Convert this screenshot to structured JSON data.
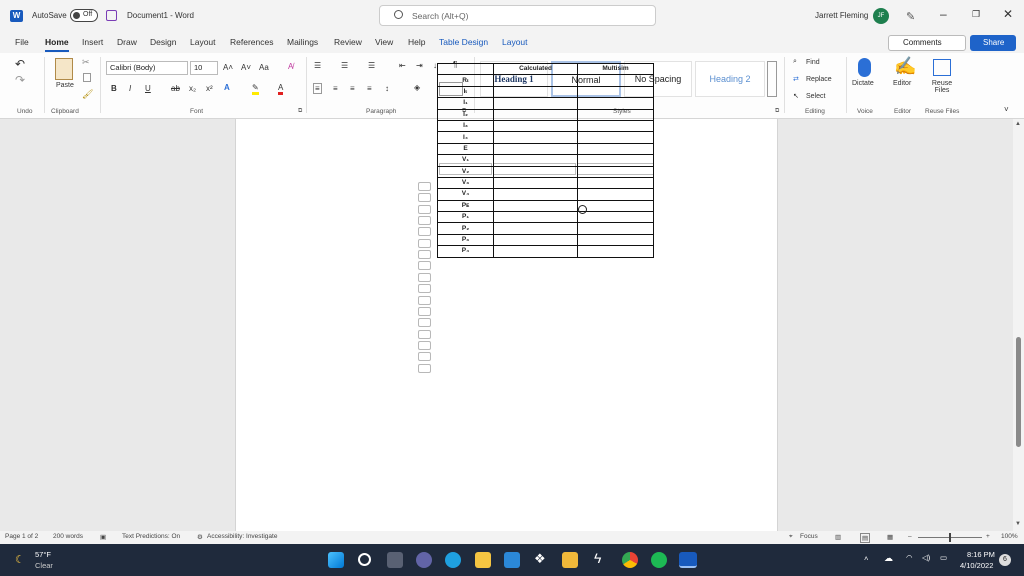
{
  "titlebar": {
    "app_logo": "W",
    "autosave_label": "AutoSave",
    "autosave_state": "Off",
    "doc_title": "Document1  -  Word",
    "search_placeholder": "Search (Alt+Q)",
    "user_name": "Jarrett Fleming",
    "user_initials": "JF"
  },
  "tabs": [
    "File",
    "Home",
    "Insert",
    "Draw",
    "Design",
    "Layout",
    "References",
    "Mailings",
    "Review",
    "View",
    "Help",
    "Table Design",
    "Layout"
  ],
  "active_tab": "Home",
  "comments_label": "Comments",
  "share_label": "Share",
  "ribbon": {
    "undo_label": "Undo",
    "paste_label": "Paste",
    "clipboard_label": "Clipboard",
    "font_name": "Calibri (Body)",
    "font_size": "10",
    "font_label": "Font",
    "paragraph_label": "Paragraph",
    "styles_label": "Styles",
    "styles": [
      "Heading 1",
      "Normal",
      "No Spacing",
      "Heading 2"
    ],
    "selected_style": "Normal",
    "find_label": "Find",
    "replace_label": "Replace",
    "select_label": "Select",
    "editing_label": "Editing",
    "dictate_label": "Dictate",
    "voice_label": "Voice",
    "editor_label": "Editor",
    "editor_group_label": "Editor",
    "reuse_label": "Reuse Files",
    "reuse_group_label": "Reuse Files"
  },
  "table": {
    "headers": [
      "",
      "Calculated",
      "Multisim"
    ],
    "rows": [
      "Rₜ",
      "Iₜ",
      "I₁",
      "I₂",
      "I₃",
      "I₄",
      "E",
      "V₁",
      "V₂",
      "V₃",
      "V₄",
      "Pᴇ",
      "P₁",
      "P₂",
      "P₃",
      "P₄"
    ]
  },
  "statusbar": {
    "page": "Page 1 of 2",
    "words": "200 words",
    "predictions": "Text Predictions: On",
    "accessibility": "Accessibility: Investigate",
    "focus": "Focus",
    "zoom": "100%"
  },
  "taskbar": {
    "weather_temp": "57°F",
    "weather_cond": "Clear",
    "time": "8:16 PM",
    "date": "4/10/2022",
    "notif_count": "6"
  }
}
